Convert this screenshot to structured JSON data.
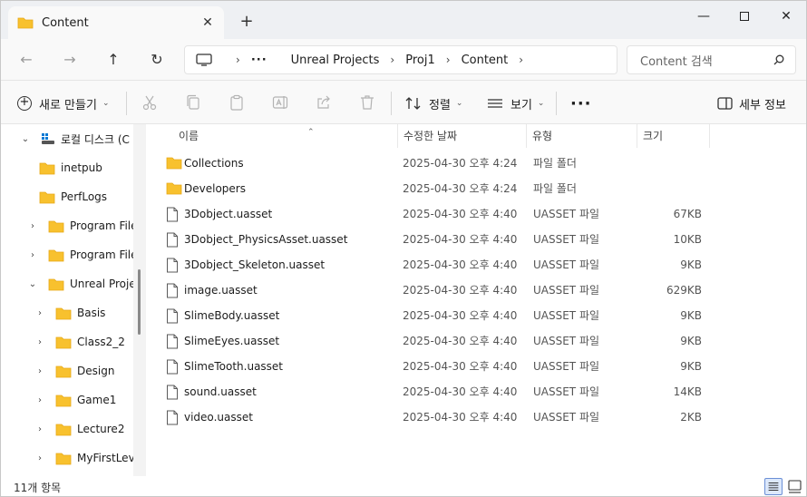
{
  "window": {
    "tab_title": "Content",
    "tab_close": "✕",
    "new_tab": "+",
    "minimize": "—",
    "close": "✕"
  },
  "nav": {
    "back": "←",
    "forward": "→",
    "up": "↑",
    "refresh": "↻",
    "more": "···",
    "breadcrumbs": [
      "Unreal Projects",
      "Proj1",
      "Content"
    ],
    "sep": "›",
    "search_placeholder": "Content 검색"
  },
  "toolbar": {
    "new_label": "새로 만들기",
    "sort_label": "정렬",
    "view_label": "보기",
    "more_label": "···",
    "details_label": "세부 정보",
    "chevron": "⌄"
  },
  "sidebar": {
    "items": [
      {
        "label": "로컬 디스크 (C",
        "chevron": "⌄",
        "icon": "drive-icon"
      },
      {
        "label": "inetpub",
        "chevron": "",
        "icon": "folder-icon"
      },
      {
        "label": "PerfLogs",
        "chevron": "",
        "icon": "folder-icon"
      },
      {
        "label": "Program Files",
        "chevron": "›",
        "icon": "folder-icon"
      },
      {
        "label": "Program Files",
        "chevron": "›",
        "icon": "folder-icon"
      },
      {
        "label": "Unreal Project",
        "chevron": "⌄",
        "icon": "folder-icon"
      },
      {
        "label": "Basis",
        "chevron": "›",
        "icon": "folder-icon"
      },
      {
        "label": "Class2_2",
        "chevron": "›",
        "icon": "folder-icon"
      },
      {
        "label": "Design",
        "chevron": "›",
        "icon": "folder-icon"
      },
      {
        "label": "Game1",
        "chevron": "›",
        "icon": "folder-icon"
      },
      {
        "label": "Lecture2",
        "chevron": "›",
        "icon": "folder-icon"
      },
      {
        "label": "MyFirstLeve",
        "chevron": "›",
        "icon": "folder-icon"
      }
    ]
  },
  "columns": {
    "name": "이름",
    "date": "수정한 날짜",
    "type": "유형",
    "size": "크기",
    "sort_indicator": "⌃"
  },
  "files": [
    {
      "name": "Collections",
      "date": "2025-04-30 오후 4:24",
      "type": "파일 폴더",
      "size": "",
      "icon": "folder-icon"
    },
    {
      "name": "Developers",
      "date": "2025-04-30 오후 4:24",
      "type": "파일 폴더",
      "size": "",
      "icon": "folder-icon"
    },
    {
      "name": "3Dobject.uasset",
      "date": "2025-04-30 오후 4:40",
      "type": "UASSET 파일",
      "size": "67KB",
      "icon": "file-icon"
    },
    {
      "name": "3Dobject_PhysicsAsset.uasset",
      "date": "2025-04-30 오후 4:40",
      "type": "UASSET 파일",
      "size": "10KB",
      "icon": "file-icon"
    },
    {
      "name": "3Dobject_Skeleton.uasset",
      "date": "2025-04-30 오후 4:40",
      "type": "UASSET 파일",
      "size": "9KB",
      "icon": "file-icon"
    },
    {
      "name": "image.uasset",
      "date": "2025-04-30 오후 4:40",
      "type": "UASSET 파일",
      "size": "629KB",
      "icon": "file-icon"
    },
    {
      "name": "SlimeBody.uasset",
      "date": "2025-04-30 오후 4:40",
      "type": "UASSET 파일",
      "size": "9KB",
      "icon": "file-icon"
    },
    {
      "name": "SlimeEyes.uasset",
      "date": "2025-04-30 오후 4:40",
      "type": "UASSET 파일",
      "size": "9KB",
      "icon": "file-icon"
    },
    {
      "name": "SlimeTooth.uasset",
      "date": "2025-04-30 오후 4:40",
      "type": "UASSET 파일",
      "size": "9KB",
      "icon": "file-icon"
    },
    {
      "name": "sound.uasset",
      "date": "2025-04-30 오후 4:40",
      "type": "UASSET 파일",
      "size": "14KB",
      "icon": "file-icon"
    },
    {
      "name": "video.uasset",
      "date": "2025-04-30 오후 4:40",
      "type": "UASSET 파일",
      "size": "2KB",
      "icon": "file-icon"
    }
  ],
  "status": {
    "item_count": "11개 항목"
  },
  "colors": {
    "folder": "#f8c12e",
    "folder_dark": "#e6a817",
    "accent": "#0067c0"
  }
}
